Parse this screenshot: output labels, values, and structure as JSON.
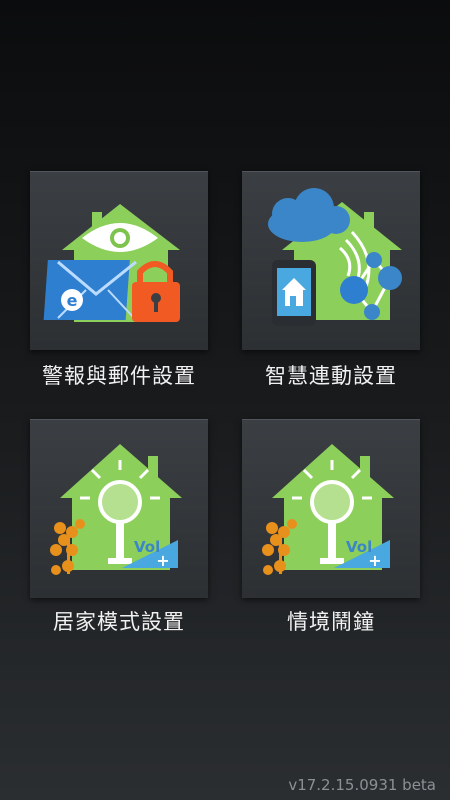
{
  "menu": {
    "items": [
      {
        "label": "警報與郵件設置",
        "icon": "alarm-email-house-icon"
      },
      {
        "label": "智慧連動設置",
        "icon": "smart-link-house-icon"
      },
      {
        "label": "居家模式設置",
        "icon": "home-mode-house-icon"
      },
      {
        "label": "情境鬧鐘",
        "icon": "scene-alarm-house-icon"
      }
    ]
  },
  "footer": {
    "version": "v17.2.15.0931 beta"
  },
  "icon_badges": {
    "email_letter": "e",
    "vol_text": "Vol",
    "plus": "+"
  },
  "colors": {
    "house_green": "#8ccf5a",
    "tile_bg": "#33373a",
    "envelope_blue": "#2f7fd1",
    "lock_orange": "#f15a22",
    "cloud_blue": "#3a86c8",
    "vol_blue": "#4aa8e0",
    "flower_orange": "#e8901c"
  }
}
